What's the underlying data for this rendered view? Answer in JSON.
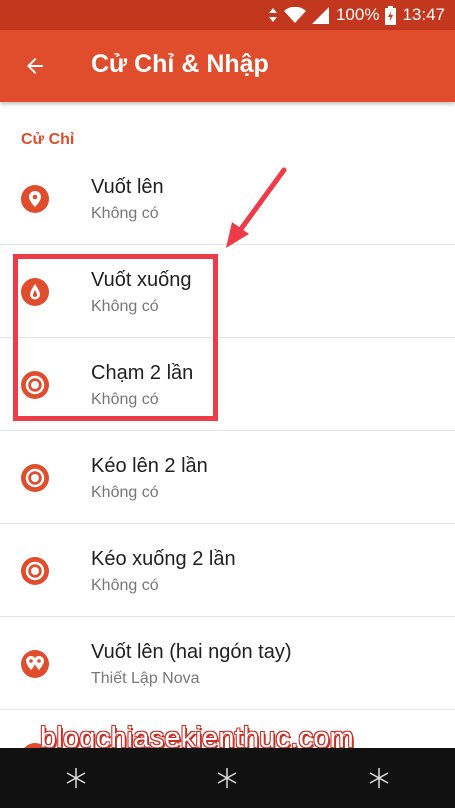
{
  "status_bar": {
    "battery": "100%",
    "time": "13:47"
  },
  "app_bar": {
    "title": "Cử Chỉ & Nhập"
  },
  "section": {
    "header": "Cử Chỉ"
  },
  "items": [
    {
      "title": "Vuốt lên",
      "subtitle": "Không có",
      "icon": "location-pin-icon"
    },
    {
      "title": "Vuốt xuống",
      "subtitle": "Không có",
      "icon": "drop-icon"
    },
    {
      "title": "Chạm 2 lần",
      "subtitle": "Không có",
      "icon": "double-tap-icon"
    },
    {
      "title": "Kéo lên 2 lần",
      "subtitle": "Không có",
      "icon": "double-tap-icon"
    },
    {
      "title": "Kéo xuống 2 lần",
      "subtitle": "Không có",
      "icon": "double-tap-icon"
    },
    {
      "title": "Vuốt lên (hai ngón tay)",
      "subtitle": "Thiết Lập Nova",
      "icon": "two-pins-icon"
    }
  ],
  "watermark": "blogchiasekienthuc.com",
  "colors": {
    "accent": "#e04d2c",
    "status_bar": "#c2371d",
    "highlight": "#ee3b48"
  }
}
